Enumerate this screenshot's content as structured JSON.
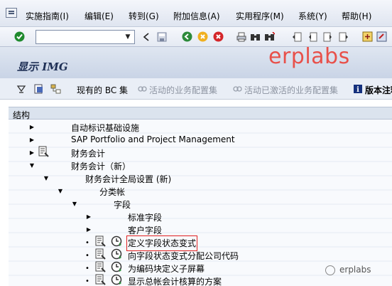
{
  "menu": {
    "items": [
      "实施指南(I)",
      "编辑(E)",
      "转到(G)",
      "附加信息(A)",
      "实用程序(M)",
      "系统(Y)",
      "帮助(H)"
    ]
  },
  "toolbar": {
    "command_value": "",
    "icons": [
      "enter-icon",
      "back-icon",
      "save-icon",
      "exit-icon",
      "cancel-icon",
      "print-icon",
      "find-icon",
      "find-next-icon",
      "first-page-icon",
      "prev-page-icon",
      "next-page-icon",
      "last-page-icon",
      "create-session-icon",
      "shortcut-icon"
    ]
  },
  "title": "显示 IMG",
  "watermark": "erplabs",
  "app_toolbar": {
    "bc_sets": "现有的 BC 集",
    "active_bc": "活动的业务配置集",
    "activated_bc": "活动已激活的业务配置集",
    "release_notes": "版本注释"
  },
  "tree": {
    "header": "结构",
    "nodes": {
      "n1": "自动标识基础设施",
      "n2": "SAP Portfolio and Project Management",
      "n3": "财务会计",
      "n4": "财务会计（新）",
      "n5": "财务会计全局设置 (新)",
      "n6": "分类帐",
      "n7": "字段",
      "n8": "标准字段",
      "n9": "客户字段",
      "n10": "定义字段状态变式",
      "n11": "向字段状态变式分配公司代码",
      "n12": "为编码块定义子屏幕",
      "n13": "显示总帐会计核算的方案"
    }
  },
  "footer_watermark": "erplabs",
  "colors": {
    "accent": "#e8504a",
    "title": "#1e2f55",
    "highlight": "#e02020"
  }
}
